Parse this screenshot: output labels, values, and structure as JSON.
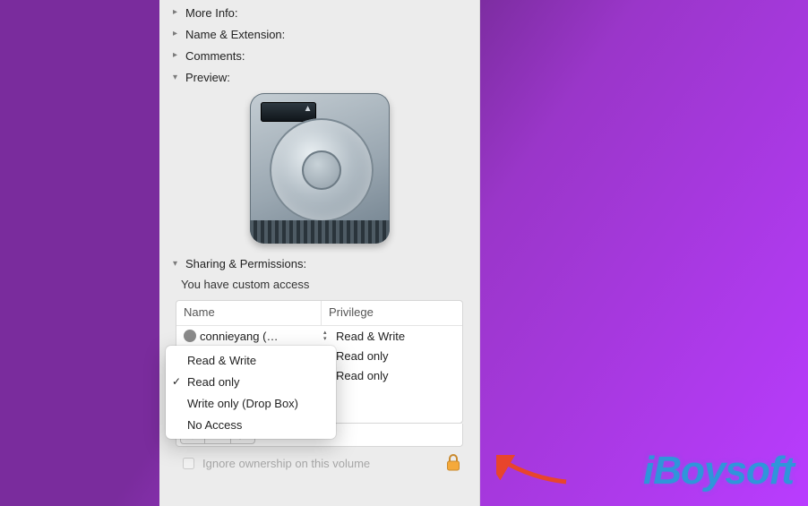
{
  "sections": {
    "more_info": "More Info:",
    "name_ext": "Name & Extension:",
    "comments": "Comments:",
    "preview": "Preview:",
    "sharing": "Sharing & Permissions:"
  },
  "sharing": {
    "status": "You have custom access",
    "columns": {
      "name": "Name",
      "privilege": "Privilege"
    },
    "rows": [
      {
        "user": "connieyang (…",
        "privilege": "Read & Write"
      },
      {
        "user": "",
        "privilege": "Read only"
      },
      {
        "user": "",
        "privilege": "Read only"
      }
    ],
    "menu": {
      "options": [
        "Read & Write",
        "Read only",
        "Write only (Drop Box)",
        "No Access"
      ],
      "selected_index": 1
    },
    "ignore_label": "Ignore ownership on this volume",
    "ignore_checked": false
  },
  "branding": {
    "logo_text": "iBoysoft"
  }
}
